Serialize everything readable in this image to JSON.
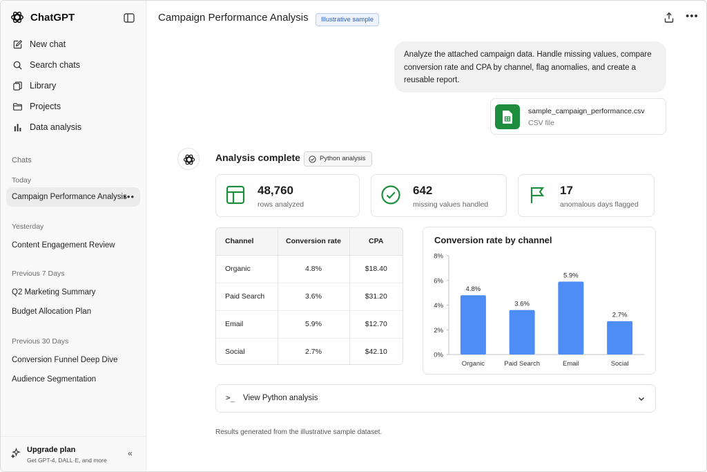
{
  "app": {
    "name": "ChatGPT"
  },
  "sidebar": {
    "nav": [
      {
        "label": "New chat",
        "icon": "edit-icon"
      },
      {
        "label": "Search chats",
        "icon": "search-icon"
      },
      {
        "label": "Library",
        "icon": "library-icon"
      },
      {
        "label": "Projects",
        "icon": "folder-icon"
      },
      {
        "label": "Data analysis",
        "icon": "bar-chart-icon"
      }
    ],
    "chats_label": "Chats",
    "sections": {
      "today": "Today",
      "yesterday": "Yesterday",
      "prev7": "Previous 7 Days",
      "prev30": "Previous 30 Days"
    },
    "chats": {
      "today": [
        "Campaign Performance Analysis"
      ],
      "yesterday": [
        "Content Engagement Review"
      ],
      "prev7": [
        "Q2 Marketing Summary",
        "Budget Allocation Plan"
      ],
      "prev30": [
        "Conversion Funnel Deep Dive",
        "Audience Segmentation"
      ]
    },
    "upgrade": {
      "title": "Upgrade plan",
      "subtitle": "Get GPT-4, DALL·E, and more"
    }
  },
  "header": {
    "title": "Campaign Performance Analysis",
    "badge": "Illustrative sample"
  },
  "conversation": {
    "user_message": "Analyze the attached campaign data. Handle missing values, compare conversion rate and CPA by channel, flag anomalies, and create a reusable report.",
    "attachment": {
      "name": "sample_campaign_performance.csv",
      "type": "CSV file"
    },
    "assistant": {
      "title": "Analysis complete",
      "badge": "Python analysis",
      "stats": [
        {
          "value": "48,760",
          "label": "rows analyzed",
          "icon": "table-icon"
        },
        {
          "value": "642",
          "label": "missing values handled",
          "icon": "check-circle-icon"
        },
        {
          "value": "17",
          "label": "anomalous days flagged",
          "icon": "flag-icon"
        }
      ],
      "table": {
        "headers": [
          "Channel",
          "Conversion rate",
          "CPA"
        ],
        "rows": [
          [
            "Organic",
            "4.8%",
            "$18.40"
          ],
          [
            "Paid Search",
            "3.6%",
            "$31.20"
          ],
          [
            "Email",
            "5.9%",
            "$12.70"
          ],
          [
            "Social",
            "2.7%",
            "$42.10"
          ]
        ]
      },
      "python_row_label": "View Python analysis",
      "footer": "Results generated from the illustrative sample dataset."
    }
  },
  "colors": {
    "accent_green": "#1e8e3e",
    "bar_blue": "#4d8df5",
    "badge_blue": "#2f5fbf"
  },
  "chart_data": {
    "type": "bar",
    "title": "Conversion rate by channel",
    "categories": [
      "Organic",
      "Paid Search",
      "Email",
      "Social"
    ],
    "values": [
      4.8,
      3.6,
      5.9,
      2.7
    ],
    "data_labels": [
      "4.8%",
      "3.6%",
      "5.9%",
      "2.7%"
    ],
    "yticks": [
      "0%",
      "2%",
      "4%",
      "6%",
      "8%"
    ],
    "ylim": [
      0,
      8
    ],
    "xlabel": "",
    "ylabel": ""
  }
}
